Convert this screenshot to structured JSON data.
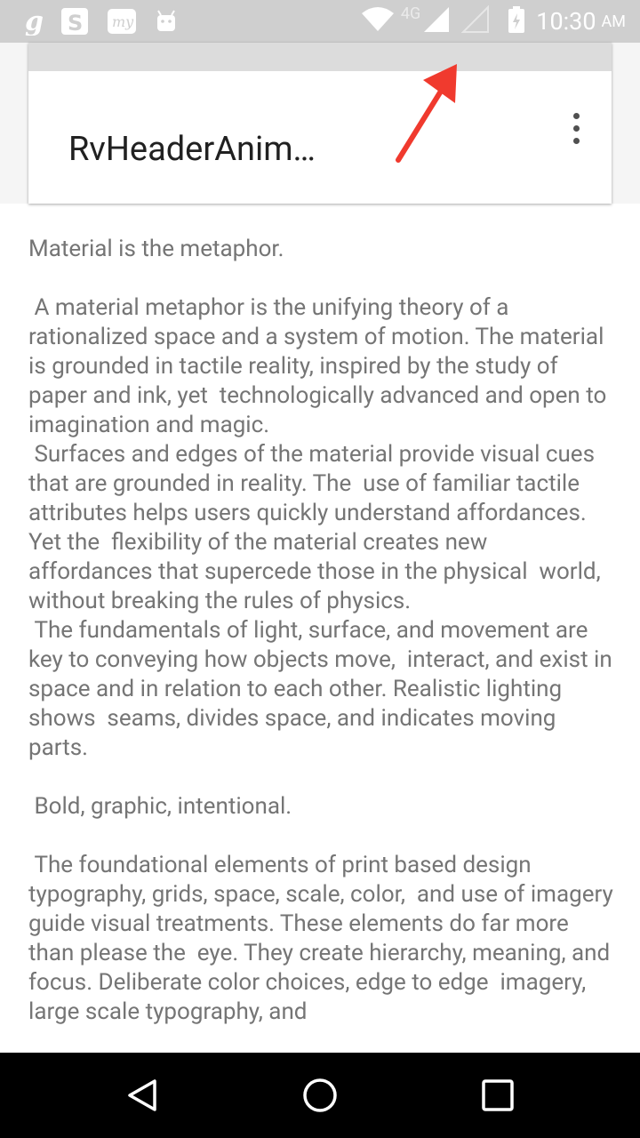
{
  "status_bar": {
    "network": "4G",
    "time": "10:30",
    "ampm": "AM",
    "notification_icons": [
      "g-icon",
      "s-icon",
      "my-icon",
      "android-icon"
    ]
  },
  "header": {
    "title": "RvHeaderAnim…"
  },
  "content": {
    "text": "Material is the metaphor.\n\n A material metaphor is the unifying theory of a rationalized space and a system of motion. The material is grounded in tactile reality, inspired by the study of paper and ink, yet  technologically advanced and open to imagination and magic.\n Surfaces and edges of the material provide visual cues that are grounded in reality. The  use of familiar tactile attributes helps users quickly understand affordances. Yet the  flexibility of the material creates new affordances that supercede those in the physical  world, without breaking the rules of physics.\n The fundamentals of light, surface, and movement are key to conveying how objects move,  interact, and exist in space and in relation to each other. Realistic lighting shows  seams, divides space, and indicates moving parts.\n\n Bold, graphic, intentional.\n\n The foundational elements of print based design typography, grids, space, scale, color,  and use of imagery guide visual treatments. These elements do far more than please the  eye. They create hierarchy, meaning, and focus. Deliberate color choices, edge to edge  imagery, large scale typography, and"
  },
  "colors": {
    "status_bar_bg": "#cfcfcf",
    "arrow": "#f03a2e",
    "body_text": "#757575"
  }
}
